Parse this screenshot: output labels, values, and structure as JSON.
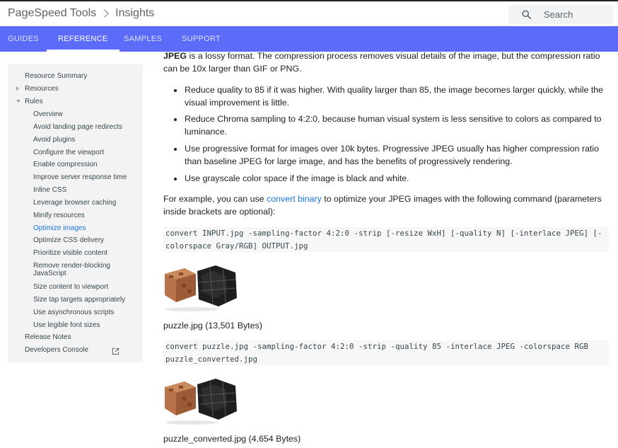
{
  "header": {
    "product": "PageSpeed Tools",
    "section": "Insights",
    "search_placeholder": "Search"
  },
  "tabs": [
    {
      "label": "GUIDES",
      "active": false
    },
    {
      "label": "REFERENCE",
      "active": true
    },
    {
      "label": "SAMPLES",
      "active": false
    },
    {
      "label": "SUPPORT",
      "active": false
    }
  ],
  "nav": {
    "resource_summary": "Resource Summary",
    "resources": "Resources",
    "rules": "Rules",
    "rule_items": [
      "Overview",
      "Avoid landing page redirects",
      "Avoid plugins",
      "Configure the viewport",
      "Enable compression",
      "Improve server response time",
      "Inline CSS",
      "Leverage browser caching",
      "Minify resources",
      "Optimize images",
      "Optimize CSS delivery",
      "Prioritize visible content",
      "Remove render-blocking JavaScript",
      "Size content to viewport",
      "Size tap targets appropriately",
      "Use asynchronous scripts",
      "Use legible font sizes"
    ],
    "active_item": "Optimize images",
    "release_notes": "Release Notes",
    "developers_console": "Developers Console"
  },
  "content": {
    "jpeg_term": "JPEG",
    "jpeg_intro": " is a lossy format. The compression process removes visual details of the image, but the compression ratio can be 10x larger than GIF or PNG.",
    "bullets": [
      "Reduce quality to 85 if it was higher. With quality larger than 85, the image becomes larger quickly, while the visual improvement is little.",
      "Reduce Chroma sampling to 4:2:0, because human visual system is less sensitive to colors as compared to luminance.",
      "Use progressive format for images over 10k bytes. Progressive JPEG usually has higher compression ratio than baseline JPEG for large image, and has the benefits of progressively rendering.",
      "Use grayscale color space if the image is black and white."
    ],
    "example_before": "For example, you can use ",
    "example_link": "convert binary",
    "example_after": " to optimize your JPEG images with the following command (parameters inside brackets are optional):",
    "command1": "convert INPUT.jpg -sampling-factor 4:2:0 -strip [-resize WxH] [-quality N] [-interlace JPEG] [-colorspace Gray/RGB] OUTPUT.jpg",
    "caption1": "puzzle.jpg (13,501 Bytes)",
    "command2": "convert puzzle.jpg -sampling-factor 4:2:0 -strip -quality 85 -interlace JPEG -colorspace RGB puzzle_converted.jpg",
    "caption2": "puzzle_converted.jpg (4,654 Bytes)"
  },
  "colors": {
    "tabbar": "#5c6bf8",
    "link": "#1a73e8",
    "nav_bg": "#f3f3f3"
  }
}
